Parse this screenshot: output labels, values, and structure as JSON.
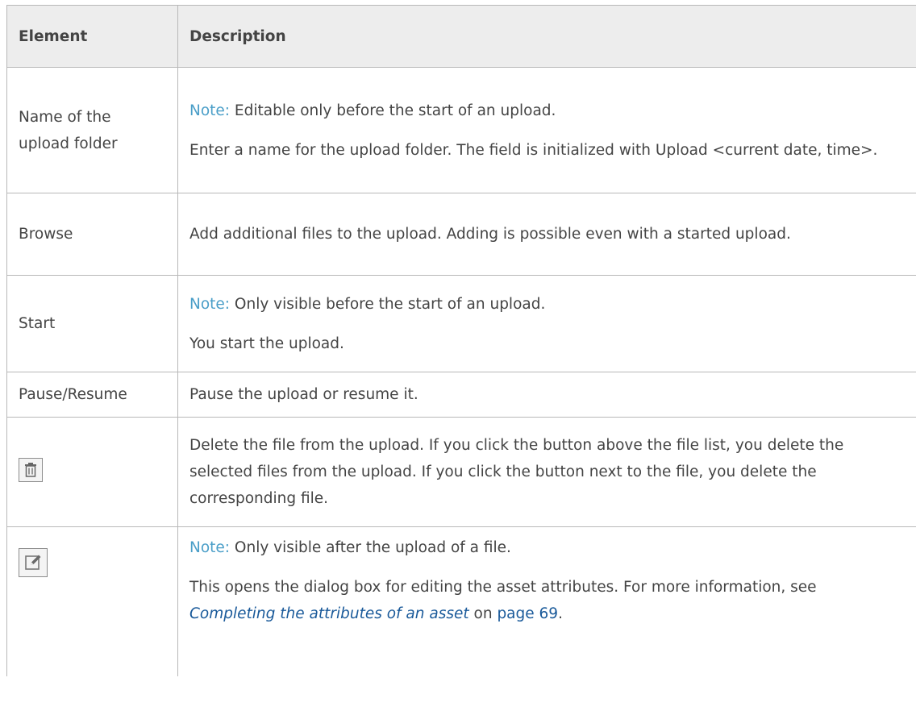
{
  "table": {
    "headers": [
      "Element",
      "Description"
    ],
    "rows": [
      {
        "element": "Name of the upload folder",
        "note_label": "Note:",
        "note_text": " Editable only before the start of an upload.",
        "desc": "Enter a name for the upload folder. The field is initialized with Upload <current date, time>."
      },
      {
        "element": "Browse",
        "desc": "Add additional files to the upload. Adding is possible even with a started upload."
      },
      {
        "element": "Start",
        "note_label": "Note:",
        "note_text": " Only visible before the start of an upload.",
        "desc": "You start the upload."
      },
      {
        "element": "Pause/Resume",
        "desc": "Pause the upload or resume it."
      },
      {
        "element_icon": "trash-icon",
        "desc": "Delete the file from the upload. If you click the button above the file list, you delete the selected files from the upload. If you click the button next to the file, you delete the corresponding file."
      },
      {
        "element_icon": "edit-icon",
        "note_label": "Note:",
        "note_text": " Only visible after the upload of a file.",
        "desc_prefix": "This opens the dialog box for editing the asset attributes. For more information, see ",
        "link_text": "Completing the attributes of an asset",
        "link_mid": " on ",
        "page_ref": "page 69",
        "desc_suffix": "."
      }
    ]
  }
}
